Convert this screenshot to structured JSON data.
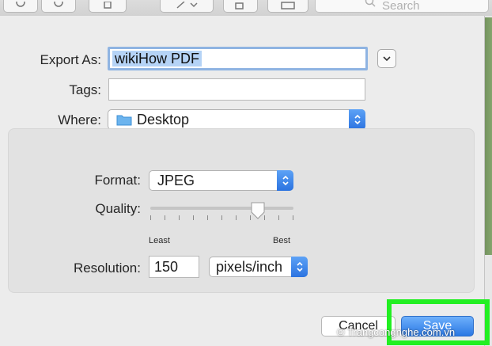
{
  "toolbar": {
    "search_placeholder": "Search"
  },
  "export_sheet": {
    "export_as_label": "Export As:",
    "export_as_value": "wikiHow PDF",
    "tags_label": "Tags:",
    "tags_value": "",
    "where_label": "Where:",
    "where_value": "Desktop"
  },
  "options": {
    "format_label": "Format:",
    "format_value": "JPEG",
    "quality_label": "Quality:",
    "quality_min_label": "Least",
    "quality_max_label": "Best",
    "quality_level": 0.75,
    "resolution_label": "Resolution:",
    "resolution_value": "150",
    "resolution_unit": "pixels/inch"
  },
  "buttons": {
    "cancel_label": "Cancel",
    "save_label": "Save"
  },
  "watermark": "© Trangcongnghe.com.vn",
  "colors": {
    "accent": "#2a78e4",
    "selection": "#b5d3f6",
    "focus_ring": "#8fb4e2",
    "highlight": "#22ef22"
  }
}
